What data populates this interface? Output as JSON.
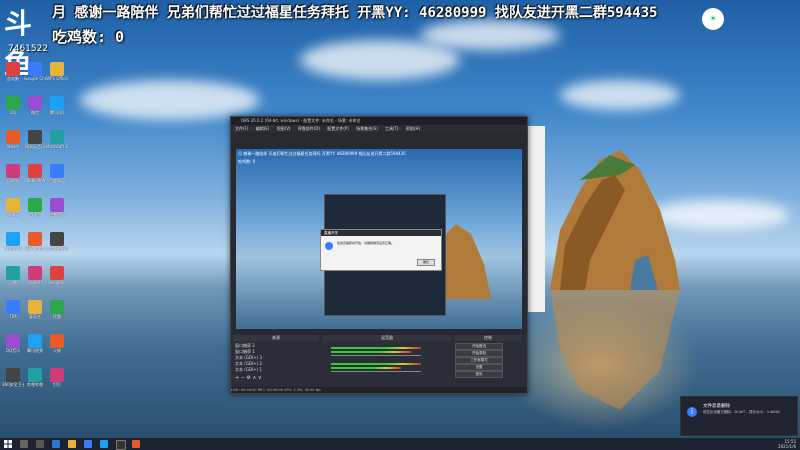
{
  "overlay": {
    "line1": "月   感谢一路陪伴  兄弟们帮忙过过福星任务拜托  开黑YY: 46280999  找队友进开黑二群594435",
    "line2": "吃鸡数: 0",
    "logo_text": "斗鱼",
    "room_id": "7461522"
  },
  "obs": {
    "title": "OBS 26.0.2 (64-bit, windows) - 配置文件: 未命名 - 场景: 未命名",
    "menu": [
      "文件(F)",
      "编辑(E)",
      "视图(V)",
      "停靠部件(D)",
      "配置文件(P)",
      "场景集合(S)",
      "工具(T)",
      "帮助(H)"
    ],
    "docks": {
      "scenes": "场景",
      "sources": "来源",
      "mixer": "混音器",
      "transitions": "转场特效",
      "controls": "控制"
    },
    "sources_list": [
      "窗口捕获 2",
      "窗口捕获 1",
      "文本 (GDI+) 3",
      "文本 (GDI+) 2",
      "文本 (GDI+) 1"
    ],
    "controls": [
      "开始推流",
      "开始录制",
      "工作室模式",
      "设置",
      "退出"
    ],
    "status": "LIVE: 00:00:00   REC: 00:00:00   CPU: 2.3%, 30.00 fps",
    "dialog": {
      "title": "直播开关",
      "message": "您的直播即将开始，请确保推流设置正确。",
      "ok": "确定"
    }
  },
  "toast": {
    "title": "文件恶意删除",
    "body": "嘻拉出设备已删除：D:\\WT... 提示大小：3.46GB"
  },
  "taskbar": {
    "time": "15:55",
    "date": "2021/1/6"
  },
  "desktop_icons": [
    "此电脑",
    "Google Chrome",
    "WPS Office",
    "QQ",
    "微信",
    "腾讯QQ",
    "Steam",
    "网易云音乐",
    "Microsoft Edge",
    "回收站",
    "Adobe Premiere",
    "百度网盘",
    "PUBG",
    "YY语音",
    "控制面板",
    "UU加速器",
    "OBS Studio",
    "斗鱼直播伴侣",
    "迅雷",
    "网易UU",
    "Wegame",
    "TIM",
    "爱奇艺",
    "优酷",
    "QQ音乐",
    "腾讯视频",
    "火绒",
    "360安全卫士",
    "哔哩哔哩",
    "钉钉"
  ],
  "colors": {
    "accent": "#3b7cff",
    "taskbar": "#1c2230",
    "obs_bg": "#272a33"
  }
}
